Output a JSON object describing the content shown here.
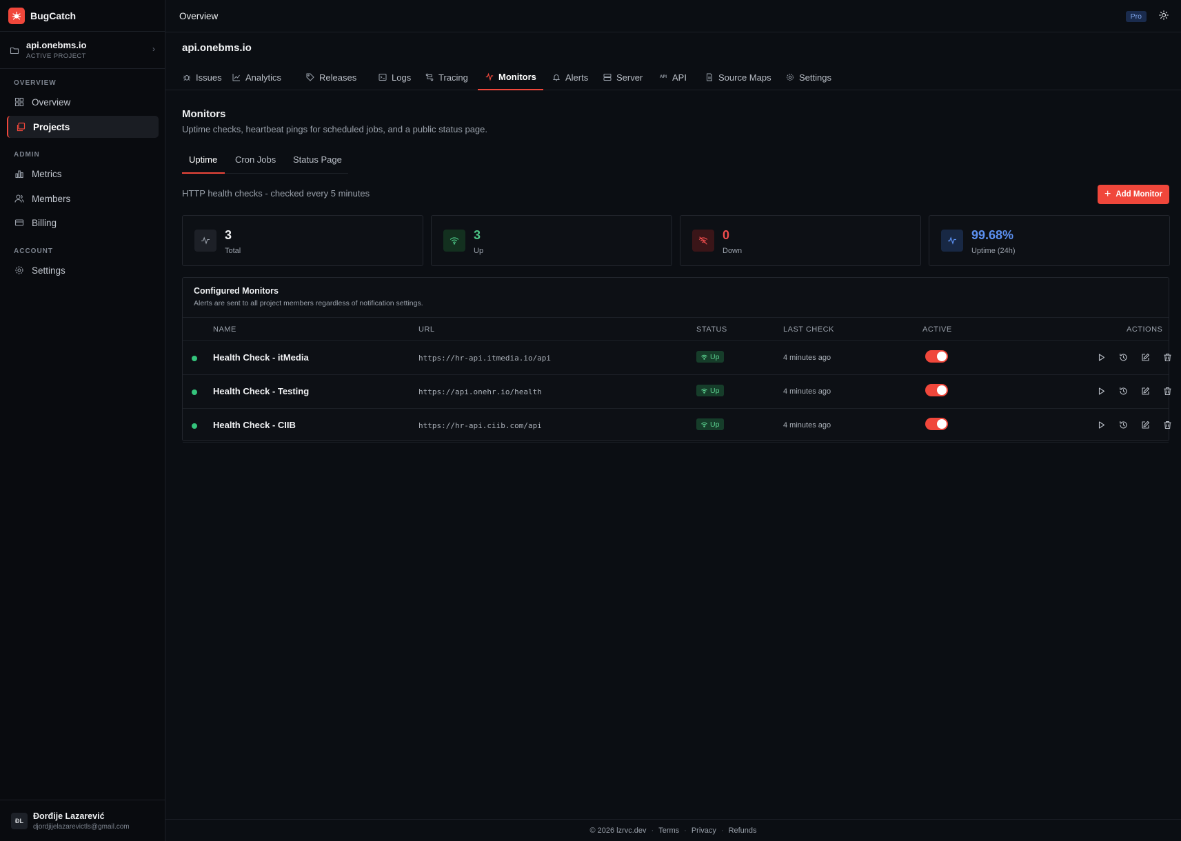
{
  "app": {
    "name": "BugCatch"
  },
  "project_switcher": {
    "name": "api.onebms.io",
    "subtitle": "ACTIVE PROJECT"
  },
  "sidebar": {
    "sections": [
      {
        "title": "OVERVIEW"
      },
      {
        "title": "ADMIN"
      },
      {
        "title": "ACCOUNT"
      }
    ],
    "items": [
      {
        "label": "Overview"
      },
      {
        "label": "Projects"
      },
      {
        "label": "Metrics"
      },
      {
        "label": "Members"
      },
      {
        "label": "Billing"
      },
      {
        "label": "Settings"
      }
    ]
  },
  "user": {
    "initials": "ĐL",
    "name": "Đorđije Lazarević",
    "email": "djordjijelazarevictls@gmail.com"
  },
  "topbar": {
    "title": "Overview",
    "plan_badge": "Pro"
  },
  "project": {
    "title": "api.onebms.io"
  },
  "tabs": [
    {
      "label": "Issues"
    },
    {
      "label": "Analytics"
    },
    {
      "label": "Releases"
    },
    {
      "label": "Logs"
    },
    {
      "label": "Tracing"
    },
    {
      "label": "Monitors"
    },
    {
      "label": "Alerts"
    },
    {
      "label": "Server"
    },
    {
      "label": "API"
    },
    {
      "label": "Source Maps"
    },
    {
      "label": "Settings"
    }
  ],
  "monitors": {
    "title": "Monitors",
    "description": "Uptime checks, heartbeat pings for scheduled jobs, and a public status page.",
    "subtabs": [
      {
        "label": "Uptime"
      },
      {
        "label": "Cron Jobs"
      },
      {
        "label": "Status Page"
      }
    ],
    "check_description": "HTTP health checks - checked every 5 minutes",
    "add_button": "Add Monitor",
    "stats": [
      {
        "value": "3",
        "label": "Total",
        "color": "#f2f3f5"
      },
      {
        "value": "3",
        "label": "Up",
        "color": "#4cc586"
      },
      {
        "value": "0",
        "label": "Down",
        "color": "#ef4d4d"
      },
      {
        "value": "99.68%",
        "label": "Uptime (24h)",
        "color": "#5b8fef"
      }
    ],
    "table": {
      "title": "Configured Monitors",
      "description": "Alerts are sent to all project members regardless of notification settings.",
      "columns": {
        "name": "NAME",
        "url": "URL",
        "status": "STATUS",
        "last_check": "LAST CHECK",
        "active": "ACTIVE",
        "actions": "ACTIONS"
      },
      "rows": [
        {
          "name": "Health Check - itMedia",
          "url": "https://hr-api.itmedia.io/api",
          "status": "Up",
          "last_check": "4 minutes ago",
          "active": true
        },
        {
          "name": "Health Check - Testing",
          "url": "https://api.onehr.io/health",
          "status": "Up",
          "last_check": "4 minutes ago",
          "active": true
        },
        {
          "name": "Health Check - CIIB",
          "url": "https://hr-api.ciib.com/api",
          "status": "Up",
          "last_check": "4 minutes ago",
          "active": true
        }
      ]
    }
  },
  "footer": {
    "copyright": "© 2026 lzrvc.dev",
    "links": [
      {
        "label": "Terms"
      },
      {
        "label": "Privacy"
      },
      {
        "label": "Refunds"
      }
    ]
  },
  "colors": {
    "accent": "#f0473b",
    "up": "#34c47c",
    "down": "#ef4d4d",
    "info": "#5b8fef"
  }
}
